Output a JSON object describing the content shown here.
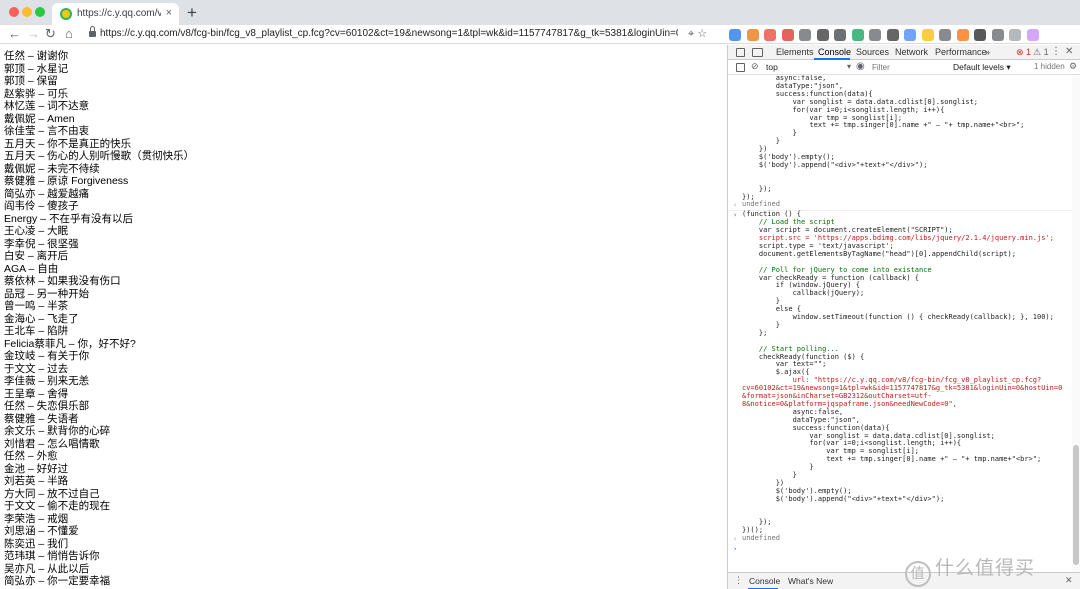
{
  "tab": {
    "title": "https://c.y.qq.com/v8/fcg-bin/",
    "close": "×"
  },
  "newtab": "+",
  "nav": {
    "back": "←",
    "forward": "→",
    "reload": "↻"
  },
  "url": {
    "host": "c.y.qq.com",
    "text": "https://c.y.qq.com/v8/fcg-bin/fcg_v8_playlist_cp.fcg?cv=60102&ct=19&newsong=1&tpl=wk&id=1157747817&g_tk=5381&loginUin=0&hostUin=0&format..."
  },
  "omni_icons": "⌖ ☆",
  "songs": [
    "任然 – 谢谢你",
    "郭顶 – 水星记",
    "郭顶 – 保留",
    "赵紫骅 – 可乐",
    "林忆莲 – 词不达意",
    "戴佩妮 – Amen",
    "徐佳莹 – 言不由衷",
    "五月天 – 你不是真正的快乐",
    "五月天 – 伤心的人别听慢歌（贯彻快乐）",
    "戴佩妮 – 未完不待续",
    "蔡健雅 – 原谅 Forgiveness",
    "简弘亦 – 越爱越痛",
    "阎韦伶 – 傻孩子",
    "Energy – 不在乎有没有以后",
    "王心凌 – 大眠",
    "李幸倪 – 很坚强",
    "白安 – 离开后",
    "AGA – 自由",
    "蔡依林 – 如果我没有伤口",
    "品冠 – 另一种开始",
    "曾一鸣 – 半茶",
    "金海心 – 飞走了",
    "王北车 – 陷阱",
    "Felicia蔡菲凡 – 你，好不好?",
    "金玟岐 – 有关于你",
    "于文文 – 过去",
    "李佳薇 – 别来无恙",
    "王呈章 – 舍得",
    "任然 – 失恋俱乐部",
    "蔡健雅 – 失语者",
    "余文乐 – 默背你的心碎",
    "刘惜君 – 怎么唱情歌",
    "任然 – 外愈",
    "金池 – 好好过",
    "刘若英 – 半路",
    "方大同 – 放不过自己",
    "于文文 – 偷不走的现在",
    "李荣浩 – 戒烟",
    "刘思涵 – 不懂爱",
    "陈奕迅 – 我们",
    "范玮琪 – 悄悄告诉你",
    "吴亦凡 – 从此以后",
    "简弘亦 – 你一定要幸福"
  ],
  "devtools": {
    "tabs": [
      "Elements",
      "Console",
      "Sources",
      "Network",
      "Performance",
      "»"
    ],
    "errors": "⊗ 1",
    "warnings": "⚠ 1",
    "context": "top",
    "filter_placeholder": "Filter",
    "levels": "Default levels ▾",
    "hidden": "1 hidden",
    "drawer_tabs": [
      "Console",
      "What's New"
    ],
    "prompt": "›",
    "result": "undefined"
  },
  "console_top": [
    "        async:false,",
    "        dataType:\"json\",",
    "        success:function(data){",
    "            var songlist = data.data.cdlist[0].songlist;",
    "            for(var i=0;i<songlist.length; i++){",
    "                var tmp = songlist[i];",
    "                text += tmp.singer[0].name +\" – \"+ tmp.name+\"<br>\";",
    "            }",
    "        }",
    "    })",
    "    $('body').empty();",
    "    $('body').append(\"<div>\"+text+\"</div>\");",
    "",
    "",
    "    });",
    "});"
  ],
  "console_main": [
    "(function () {",
    "    // Load the script",
    "    var script = document.createElement(\"SCRIPT\");",
    "    script.src = 'https://apps.bdimg.com/libs/jquery/2.1.4/jquery.min.js';",
    "    script.type = 'text/javascript';",
    "    document.getElementsByTagName(\"head\")[0].appendChild(script);",
    "",
    "    // Poll for jQuery to come into existance",
    "    var checkReady = function (callback) {",
    "        if (window.jQuery) {",
    "            callback(jQuery);",
    "        }",
    "        else {",
    "            window.setTimeout(function () { checkReady(callback); }, 100);",
    "        }",
    "    };",
    "",
    "    // Start polling...",
    "    checkReady(function ($) {",
    "        var text=\"\";",
    "        $.ajax({",
    "            url: \"https://c.y.qq.com/v8/fcg-bin/fcg_v8_playlist_cp.fcg?",
    "cv=60102&ct=19&newsong=1&tpl=wk&id=1157747817&g_tk=5381&loginUin=0&hostUin=0",
    "&format=json&inCharset=GB2312&outCharset=utf-",
    "8&notice=0&platform=jqspaframe.json&needNewCode=0\",",
    "            async:false,",
    "            dataType:\"json\",",
    "            success:function(data){",
    "                var songlist = data.data.cdlist[0].songlist;",
    "                for(var i=0;i<songlist.length; i++){",
    "                    var tmp = songlist[i];",
    "                    text += tmp.singer[0].name +\" – \"+ tmp.name+\"<br>\";",
    "                }",
    "            }",
    "        })",
    "        $('body').empty();",
    "        $('body').append(\"<div>\"+text+\"</div>\");",
    "",
    "",
    "    });",
    "})();"
  ],
  "watermark": {
    "badge": "值",
    "text": "什么值得买"
  },
  "colors": {
    "accent": "#1a73e8",
    "tabstrip": "#dee1e6",
    "error": "#d93025"
  }
}
